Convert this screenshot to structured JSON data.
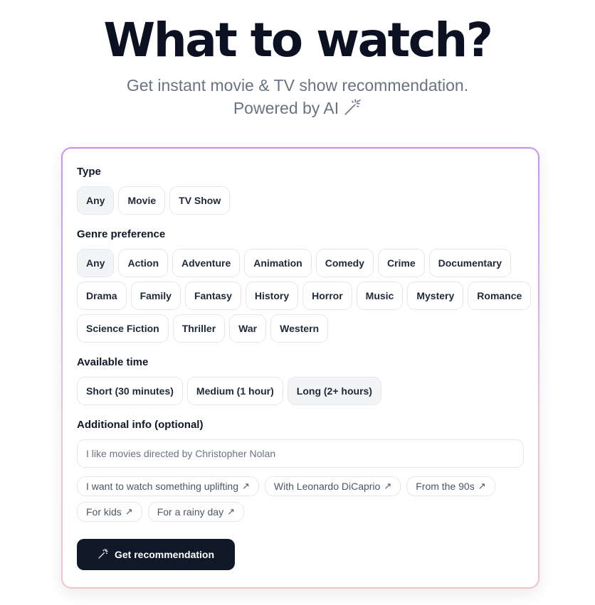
{
  "header": {
    "title": "What to watch?",
    "subtitle_line1": "Get instant movie & TV show recommendation.",
    "subtitle_line2": "Powered by AI",
    "subtitle_icon": "magic-wand-icon"
  },
  "form": {
    "type": {
      "label": "Type",
      "options": [
        "Any",
        "Movie",
        "TV Show"
      ],
      "selected": "Any"
    },
    "genre": {
      "label": "Genre preference",
      "options_row1": [
        "Any",
        "Action",
        "Adventure",
        "Animation",
        "Comedy",
        "Crime",
        "Documentary"
      ],
      "options_row2": [
        "Drama",
        "Family",
        "Fantasy",
        "History",
        "Horror",
        "Music",
        "Mystery",
        "Romance"
      ],
      "options_row3": [
        "Science Fiction",
        "Thriller",
        "War",
        "Western"
      ],
      "selected": "Any"
    },
    "time": {
      "label": "Available time",
      "options": [
        "Short (30 minutes)",
        "Medium (1 hour)",
        "Long (2+ hours)"
      ],
      "selected": "Long (2+ hours)"
    },
    "additional": {
      "label": "Additional info (optional)",
      "placeholder": "I like movies directed by Christopher Nolan",
      "value": "",
      "suggestions_row1": [
        "I want to watch something uplifting",
        "With Leonardo DiCaprio",
        "From the 90s"
      ],
      "suggestions_row2": [
        "For kids",
        "For a rainy day"
      ],
      "suggestion_icon": "arrow-up-right-icon",
      "suggestion_arrow": "↗"
    },
    "submit": {
      "label": "Get recommendation",
      "icon": "magic-wand-icon"
    }
  },
  "colors": {
    "primary_button": "#111827",
    "selected_chip": "#f3f4f6",
    "card_border_top": "#c98ff0",
    "card_border_bottom": "#f6c1c6",
    "muted_text": "#6b7280"
  }
}
